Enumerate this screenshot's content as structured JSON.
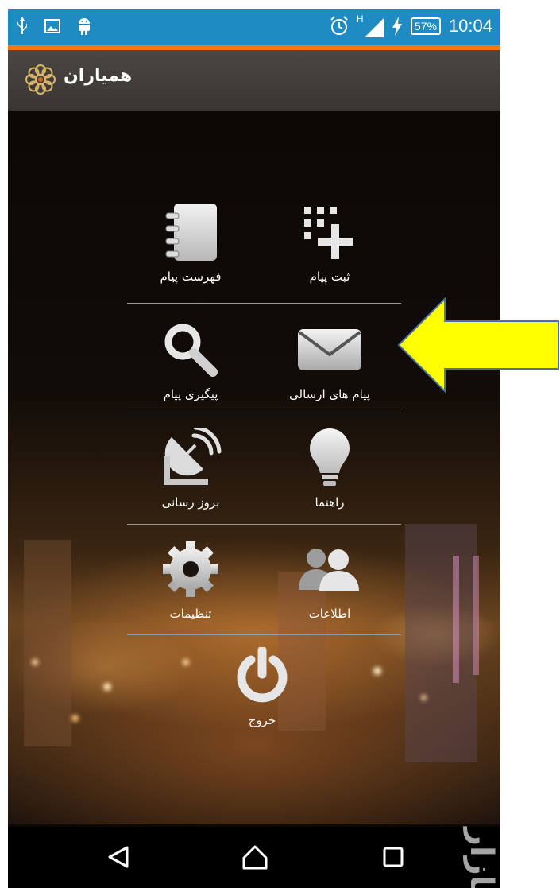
{
  "status_bar": {
    "left_icons": [
      "usb-icon",
      "image-icon",
      "android-icon"
    ],
    "right_icons": [
      "alarm-icon",
      "signal-icon",
      "charging-icon"
    ],
    "network_type": "H",
    "battery_percent": "57%",
    "time": "10:04",
    "background_color": "#1e8cc2",
    "accent_line_color": "#f4770f"
  },
  "action_bar": {
    "title": "همیاران",
    "logo_icon": "flower-emblem-icon"
  },
  "menu": {
    "row1": {
      "right": {
        "label": "ثبت پیام",
        "icon": "add-grid-icon"
      },
      "left": {
        "label": "فهرست پیام",
        "icon": "notebook-icon"
      }
    },
    "row2": {
      "right": {
        "label": "پیام های ارسالی",
        "icon": "envelope-icon"
      },
      "left": {
        "label": "پیگیری پیام",
        "icon": "search-icon"
      }
    },
    "row3": {
      "right": {
        "label": "راهنما",
        "icon": "lightbulb-icon"
      },
      "left": {
        "label": "بروز رسانی",
        "icon": "satellite-dish-icon"
      }
    },
    "row4": {
      "right": {
        "label": "اطلاعات",
        "icon": "users-icon"
      },
      "left": {
        "label": "تنظیمات",
        "icon": "gear-icon"
      }
    },
    "exit": {
      "label": "خروج",
      "icon": "power-icon"
    }
  },
  "annotation": {
    "icon": "arrow-left-icon",
    "fill_color": "#ffff00",
    "stroke_color": "#4a6fa0"
  },
  "nav_bar": {
    "buttons": [
      "back-icon",
      "home-icon",
      "recents-icon"
    ]
  },
  "watermark": {
    "text": "بازار"
  }
}
